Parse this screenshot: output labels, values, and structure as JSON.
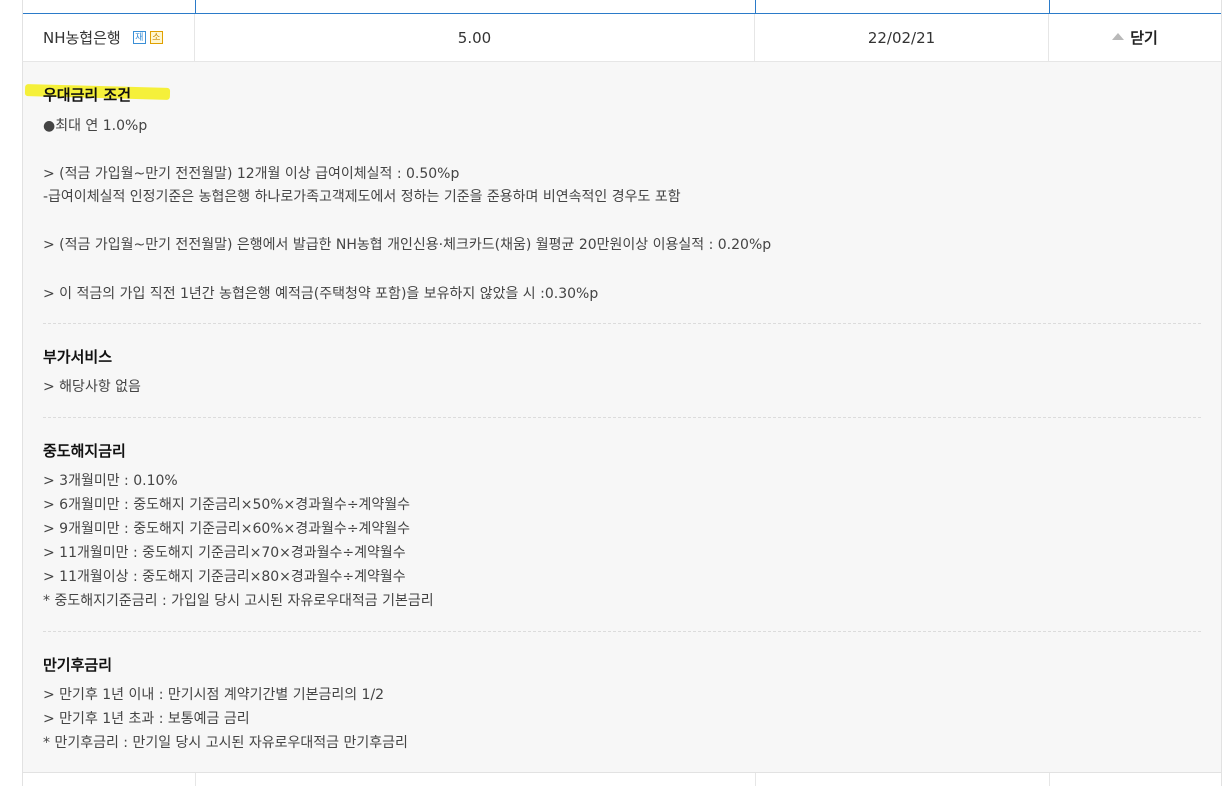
{
  "row": {
    "bank_name": "NH농협은행",
    "badge_1": "재",
    "badge_2": "소",
    "rate": "5.00",
    "date": "22/02/21",
    "toggle_label": "닫기"
  },
  "colors": {
    "highlight": "#f5f03a",
    "header_rule": "#2b7bc9",
    "panel_bg": "#f7f7f7"
  },
  "sections": {
    "preferential": {
      "title": "우대금리 조건",
      "lines": [
        "●최대 연 1.0%p",
        "> (적금 가입월~만기 전전월말) 12개월 이상 급여이체실적 : 0.50%p",
        "-급여이체실적 인정기준은 농협은행 하나로가족고객제도에서 정하는 기준을 준용하며 비연속적인 경우도 포함",
        "> (적금 가입월~만기 전전월말) 은행에서 발급한 NH농협 개인신용·체크카드(채움) 월평균 20만원이상 이용실적 : 0.20%p",
        "> 이 적금의 가입 직전 1년간 농협은행 예적금(주택청약 포함)을 보유하지 않았을 시 :0.30%p"
      ]
    },
    "additional": {
      "title": "부가서비스",
      "lines": [
        "> 해당사항 없음"
      ]
    },
    "early_termination": {
      "title": "중도해지금리",
      "lines": [
        "> 3개월미만 : 0.10%",
        "> 6개월미만 : 중도해지 기준금리×50%×경과월수÷계약월수",
        "> 9개월미만 : 중도해지 기준금리×60%×경과월수÷계약월수",
        "> 11개월미만 : 중도해지 기준금리×70×경과월수÷계약월수",
        "> 11개월이상 : 중도해지 기준금리×80×경과월수÷계약월수",
        "* 중도해지기준금리 : 가입일 당시 고시된 자유로우대적금 기본금리"
      ]
    },
    "post_maturity": {
      "title": "만기후금리",
      "lines": [
        "> 만기후 1년 이내 : 만기시점 계약기간별 기본금리의 1/2",
        "> 만기후 1년 초과 : 보통예금 금리",
        "* 만기후금리 : 만기일 당시 고시된 자유로우대적금 만기후금리"
      ]
    }
  }
}
